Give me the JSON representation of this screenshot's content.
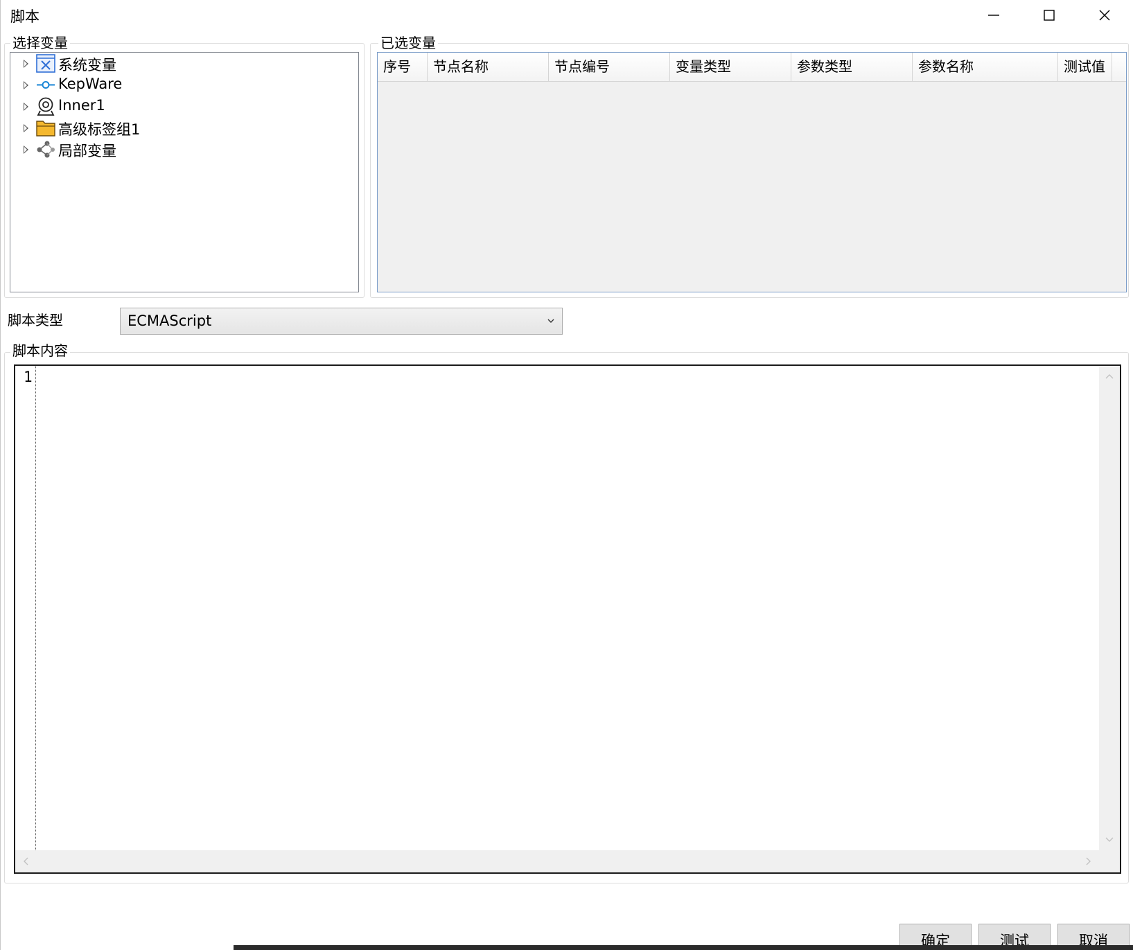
{
  "window": {
    "title": "脚本",
    "minimize_icon": "minimize-icon",
    "maximize_icon": "maximize-icon",
    "close_icon": "close-icon"
  },
  "select_vars": {
    "legend": "选择变量",
    "items": [
      {
        "label": "系统变量",
        "icon": "system-variable-icon"
      },
      {
        "label": "KepWare",
        "icon": "connector-icon"
      },
      {
        "label": "Inner1",
        "icon": "inner-node-icon"
      },
      {
        "label": "高级标签组1",
        "icon": "folder-icon"
      },
      {
        "label": "局部变量",
        "icon": "share-icon"
      }
    ]
  },
  "selected_vars": {
    "legend": "已选变量",
    "columns": [
      "序号",
      "节点名称",
      "节点编号",
      "变量类型",
      "参数类型",
      "参数名称",
      "测试值"
    ],
    "rows": []
  },
  "script_type": {
    "label": "脚本类型",
    "value": "ECMAScript"
  },
  "script_content": {
    "legend": "脚本内容",
    "line_numbers": [
      "1"
    ],
    "text": ""
  },
  "buttons": {
    "ok": "确定",
    "test": "测试",
    "cancel": "取消"
  },
  "colors": {
    "grid_border": "#7a9cc8",
    "grid_background": "#f0f0f0",
    "folder": "#f5b82e",
    "system_icon": "#2f6fd6",
    "connector": "#1a86d6"
  }
}
